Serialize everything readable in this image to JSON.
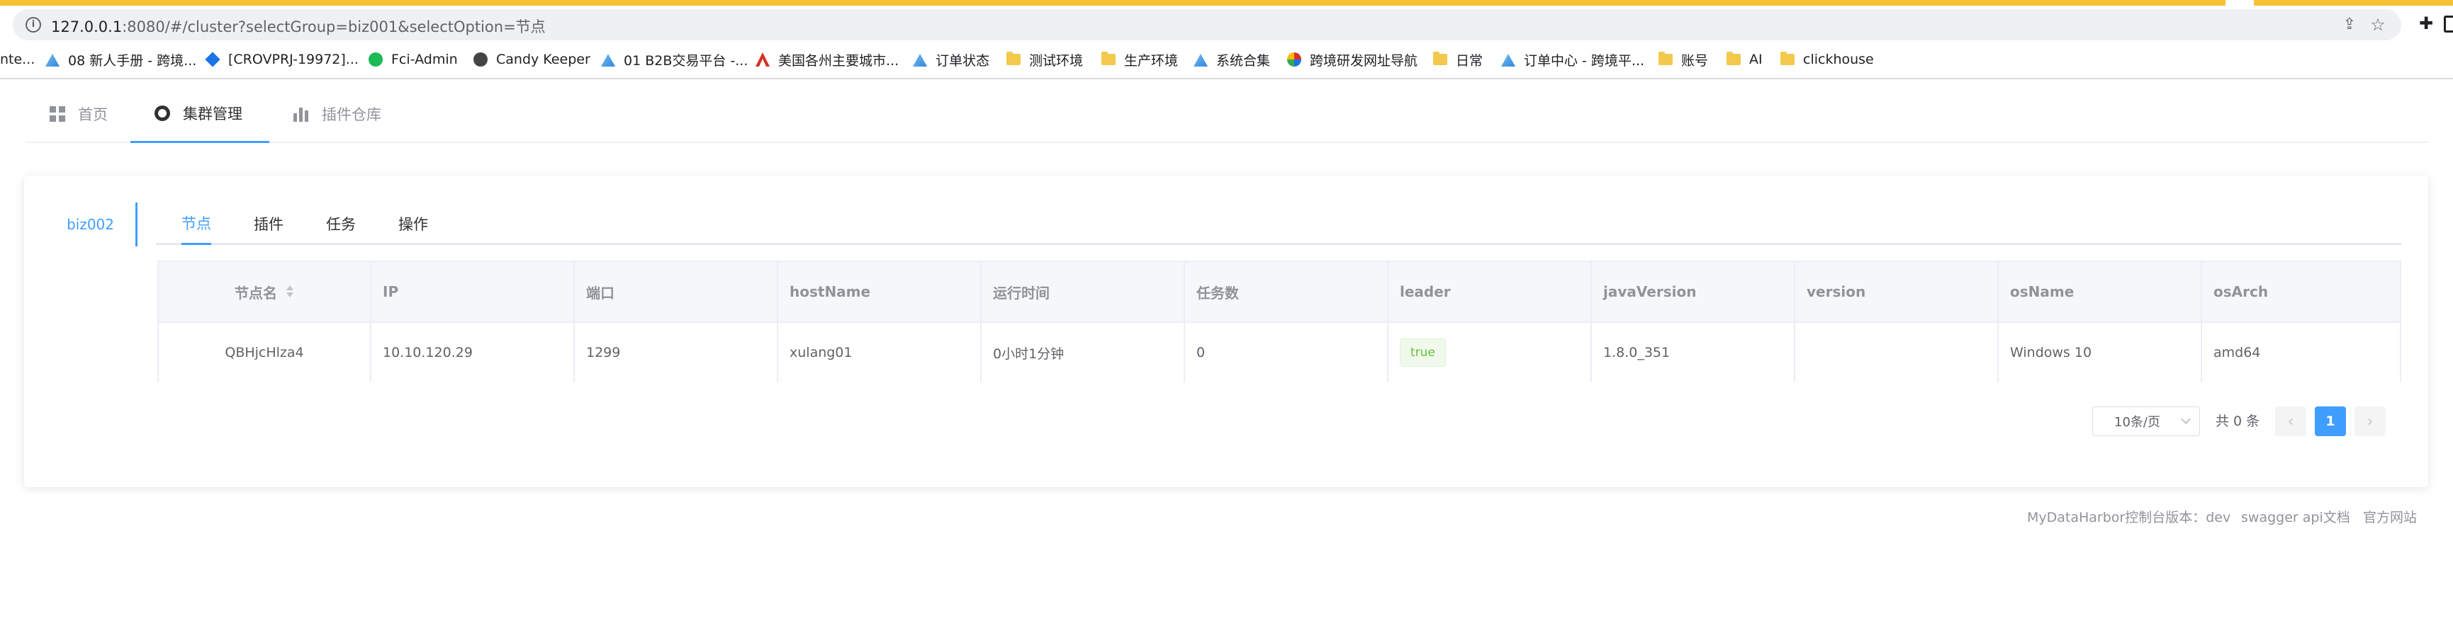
{
  "browser": {
    "url_host": "127.0.0.1",
    "url_rest": ":8080/#/cluster?selectGroup=biz001&selectOption=节点",
    "bookmarks": [
      {
        "label": "nte...",
        "icon": "none"
      },
      {
        "label": "08 新人手册 - 跨境...",
        "icon": "blue"
      },
      {
        "label": "[CROVPRJ-19972]...",
        "icon": "diamond"
      },
      {
        "label": "Fci-Admin",
        "icon": "green"
      },
      {
        "label": "Candy Keeper",
        "icon": "gray"
      },
      {
        "label": "01 B2B交易平台 -...",
        "icon": "blue"
      },
      {
        "label": "美国各州主要城市...",
        "icon": "red"
      },
      {
        "label": "订单状态",
        "icon": "blue"
      },
      {
        "label": "测试环境",
        "icon": "folder"
      },
      {
        "label": "生产环境",
        "icon": "folder"
      },
      {
        "label": "系统合集",
        "icon": "blue"
      },
      {
        "label": "跨境研发网址导航",
        "icon": "globe"
      },
      {
        "label": "日常",
        "icon": "folder"
      },
      {
        "label": "订单中心 - 跨境平...",
        "icon": "blue"
      },
      {
        "label": "账号",
        "icon": "folder"
      },
      {
        "label": "AI",
        "icon": "folder"
      },
      {
        "label": "clickhouse",
        "icon": "folder"
      }
    ]
  },
  "nav": {
    "home": "首页",
    "cluster": "集群管理",
    "plugins": "插件仓库"
  },
  "group": {
    "selected": "biz002"
  },
  "subtabs": [
    "节点",
    "插件",
    "任务",
    "操作"
  ],
  "table": {
    "columns": [
      "节点名",
      "IP",
      "端口",
      "hostName",
      "运行时间",
      "任务数",
      "leader",
      "javaVersion",
      "version",
      "osName",
      "osArch"
    ],
    "rows": [
      [
        "QBHjcHlza4",
        "10.10.120.29",
        "1299",
        "xulang01",
        "0小时1分钟",
        "0",
        "true",
        "1.8.0_351",
        "",
        "Windows 10",
        "amd64"
      ]
    ]
  },
  "pagination": {
    "page_size": "10条/页",
    "total": "共 0 条",
    "current_page": "1",
    "prev": "‹",
    "next": "›"
  },
  "footer": {
    "version_label": "MyDataHarbor控制台版本：",
    "version": "dev",
    "swagger": "swagger api文档",
    "official": "官方网站"
  },
  "colors": {
    "accent": "#409eff",
    "success": "#67c23a",
    "browser_accent": "#f6c234"
  }
}
